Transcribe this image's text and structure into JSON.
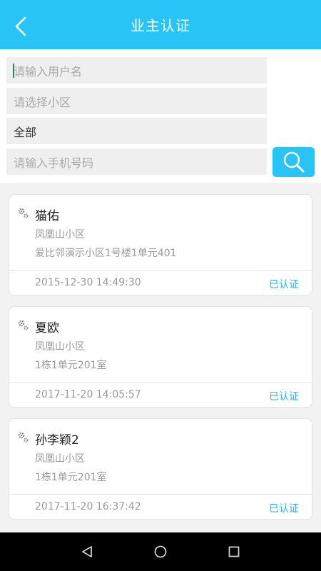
{
  "header": {
    "title": "业主认证"
  },
  "filters": {
    "username_placeholder": "请输入用户名",
    "community_placeholder": "请选择小区",
    "category_value": "全部",
    "phone_placeholder": "请输入手机号码"
  },
  "records": [
    {
      "name": "猫佑",
      "community": "凤凰山小区",
      "address": "爱比邻演示小区1号楼1单元401",
      "time": "2015-12-30 14:49:30",
      "status": "已认证"
    },
    {
      "name": "夏欧",
      "community": "凤凰山小区",
      "address": "1栋1单元201室",
      "time": "2017-11-20 14:05:57",
      "status": "已认证"
    },
    {
      "name": "孙李颖2",
      "community": "凤凰山小区",
      "address": "1栋1单元201室",
      "time": "2017-11-20 16:37:42",
      "status": "已认证"
    }
  ],
  "colors": {
    "accent": "#29c4f6",
    "status_text": "#29b4f2"
  },
  "icons": {
    "back": "back-arrow-icon",
    "search": "search-icon",
    "gear": "gear-icon",
    "nav_back": "nav-back-icon",
    "nav_home": "nav-home-icon",
    "nav_recent": "nav-recent-icon"
  }
}
